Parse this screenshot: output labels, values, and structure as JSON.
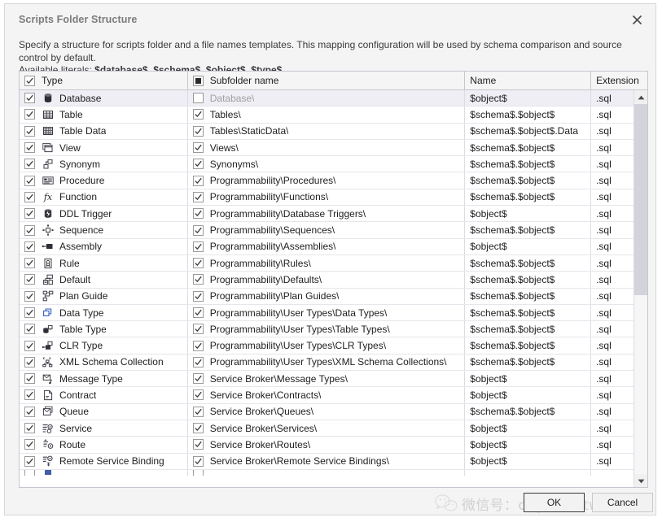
{
  "dialog": {
    "title": "Scripts Folder Structure",
    "close_icon": "close-icon",
    "description_line1": "Specify a structure for scripts folder and a file names templates. This mapping configuration will be used by schema comparison and source control by default.",
    "description_line2_prefix": "Available literals: ",
    "literals": "$database$, $schema$, $object$, $type$.",
    "ok_label": "OK",
    "cancel_label": "Cancel"
  },
  "watermark": {
    "text": "微信号：cogitosoftware",
    "logo_icon": "wechat-icon"
  },
  "grid": {
    "headers": {
      "type": "Type",
      "subfolder": "Subfolder name",
      "name": "Name",
      "extension": "Extension"
    },
    "header_type_checked": true,
    "header_subfolder_state": "indeterminate",
    "scrollbar": {
      "up_icon": "scroll-up-icon",
      "down_icon": "scroll-down-icon"
    },
    "rows": [
      {
        "checked": true,
        "icon": "database-icon",
        "type": "Database",
        "sub_checked": false,
        "subfolder": "Database\\",
        "name": "$object$",
        "ext": ".sql",
        "selected": true,
        "sub_muted": true
      },
      {
        "checked": true,
        "icon": "table-icon",
        "type": "Table",
        "sub_checked": true,
        "subfolder": "Tables\\",
        "name": "$schema$.$object$",
        "ext": ".sql",
        "selected": false,
        "sub_muted": false
      },
      {
        "checked": true,
        "icon": "table-data-icon",
        "type": "Table Data",
        "sub_checked": true,
        "subfolder": "Tables\\StaticData\\",
        "name": "$schema$.$object$.Data",
        "ext": ".sql",
        "selected": false,
        "sub_muted": false
      },
      {
        "checked": true,
        "icon": "view-icon",
        "type": "View",
        "sub_checked": true,
        "subfolder": "Views\\",
        "name": "$schema$.$object$",
        "ext": ".sql",
        "selected": false,
        "sub_muted": false
      },
      {
        "checked": true,
        "icon": "synonym-icon",
        "type": "Synonym",
        "sub_checked": true,
        "subfolder": "Synonyms\\",
        "name": "$schema$.$object$",
        "ext": ".sql",
        "selected": false,
        "sub_muted": false
      },
      {
        "checked": true,
        "icon": "procedure-icon",
        "type": "Procedure",
        "sub_checked": true,
        "subfolder": "Programmability\\Procedures\\",
        "name": "$schema$.$object$",
        "ext": ".sql",
        "selected": false,
        "sub_muted": false
      },
      {
        "checked": true,
        "icon": "function-icon",
        "type": "Function",
        "sub_checked": true,
        "subfolder": "Programmability\\Functions\\",
        "name": "$schema$.$object$",
        "ext": ".sql",
        "selected": false,
        "sub_muted": false
      },
      {
        "checked": true,
        "icon": "ddl-trigger-icon",
        "type": "DDL Trigger",
        "sub_checked": true,
        "subfolder": "Programmability\\Database Triggers\\",
        "name": "$object$",
        "ext": ".sql",
        "selected": false,
        "sub_muted": false
      },
      {
        "checked": true,
        "icon": "sequence-icon",
        "type": "Sequence",
        "sub_checked": true,
        "subfolder": "Programmability\\Sequences\\",
        "name": "$schema$.$object$",
        "ext": ".sql",
        "selected": false,
        "sub_muted": false
      },
      {
        "checked": true,
        "icon": "assembly-icon",
        "type": "Assembly",
        "sub_checked": true,
        "subfolder": "Programmability\\Assemblies\\",
        "name": "$object$",
        "ext": ".sql",
        "selected": false,
        "sub_muted": false
      },
      {
        "checked": true,
        "icon": "rule-icon",
        "type": "Rule",
        "sub_checked": true,
        "subfolder": "Programmability\\Rules\\",
        "name": "$schema$.$object$",
        "ext": ".sql",
        "selected": false,
        "sub_muted": false
      },
      {
        "checked": true,
        "icon": "default-icon",
        "type": "Default",
        "sub_checked": true,
        "subfolder": "Programmability\\Defaults\\",
        "name": "$schema$.$object$",
        "ext": ".sql",
        "selected": false,
        "sub_muted": false
      },
      {
        "checked": true,
        "icon": "plan-guide-icon",
        "type": "Plan Guide",
        "sub_checked": true,
        "subfolder": "Programmability\\Plan Guides\\",
        "name": "$schema$.$object$",
        "ext": ".sql",
        "selected": false,
        "sub_muted": false
      },
      {
        "checked": true,
        "icon": "data-type-icon",
        "type": "Data Type",
        "sub_checked": true,
        "subfolder": "Programmability\\User Types\\Data Types\\",
        "name": "$schema$.$object$",
        "ext": ".sql",
        "selected": false,
        "sub_muted": false
      },
      {
        "checked": true,
        "icon": "table-type-icon",
        "type": "Table Type",
        "sub_checked": true,
        "subfolder": "Programmability\\User Types\\Table Types\\",
        "name": "$schema$.$object$",
        "ext": ".sql",
        "selected": false,
        "sub_muted": false
      },
      {
        "checked": true,
        "icon": "clr-type-icon",
        "type": "CLR Type",
        "sub_checked": true,
        "subfolder": "Programmability\\User Types\\CLR Types\\",
        "name": "$schema$.$object$",
        "ext": ".sql",
        "selected": false,
        "sub_muted": false
      },
      {
        "checked": true,
        "icon": "xml-schema-icon",
        "type": "XML Schema Collection",
        "sub_checked": true,
        "subfolder": "Programmability\\User Types\\XML Schema Collections\\",
        "name": "$schema$.$object$",
        "ext": ".sql",
        "selected": false,
        "sub_muted": false
      },
      {
        "checked": true,
        "icon": "message-type-icon",
        "type": "Message Type",
        "sub_checked": true,
        "subfolder": "Service Broker\\Message Types\\",
        "name": "$object$",
        "ext": ".sql",
        "selected": false,
        "sub_muted": false
      },
      {
        "checked": true,
        "icon": "contract-icon",
        "type": "Contract",
        "sub_checked": true,
        "subfolder": "Service Broker\\Contracts\\",
        "name": "$object$",
        "ext": ".sql",
        "selected": false,
        "sub_muted": false
      },
      {
        "checked": true,
        "icon": "queue-icon",
        "type": "Queue",
        "sub_checked": true,
        "subfolder": "Service Broker\\Queues\\",
        "name": "$schema$.$object$",
        "ext": ".sql",
        "selected": false,
        "sub_muted": false
      },
      {
        "checked": true,
        "icon": "service-icon",
        "type": "Service",
        "sub_checked": true,
        "subfolder": "Service Broker\\Services\\",
        "name": "$object$",
        "ext": ".sql",
        "selected": false,
        "sub_muted": false
      },
      {
        "checked": true,
        "icon": "route-icon",
        "type": "Route",
        "sub_checked": true,
        "subfolder": "Service Broker\\Routes\\",
        "name": "$object$",
        "ext": ".sql",
        "selected": false,
        "sub_muted": false
      },
      {
        "checked": true,
        "icon": "remote-binding-icon",
        "type": "Remote Service Binding",
        "sub_checked": true,
        "subfolder": "Service Broker\\Remote Service Bindings\\",
        "name": "$object$",
        "ext": ".sql",
        "selected": false,
        "sub_muted": false
      }
    ]
  }
}
